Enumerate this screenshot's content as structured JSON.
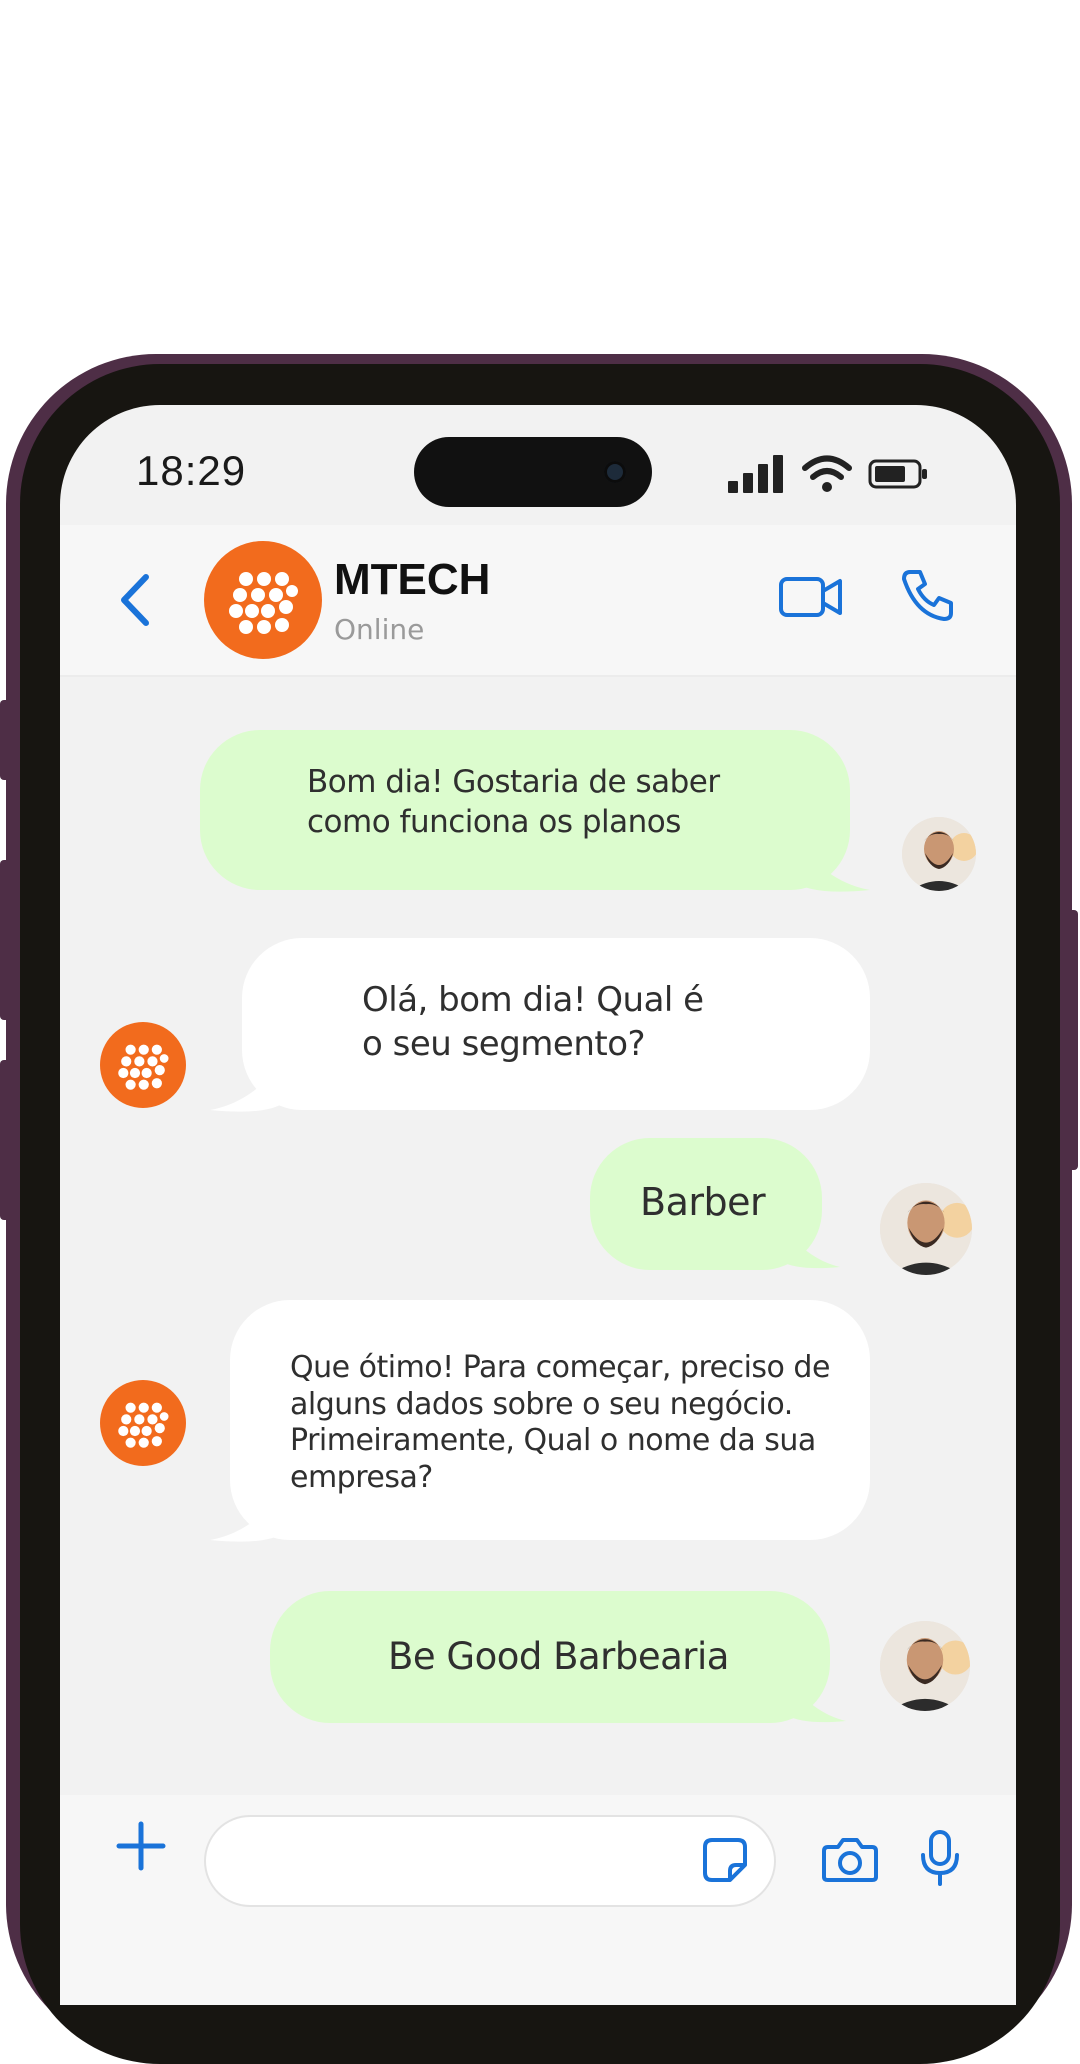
{
  "status_bar": {
    "time": "18:29"
  },
  "contact": {
    "name": "MTECH",
    "status": "Online"
  },
  "messages": [
    {
      "from": "user",
      "lines": [
        "Bom dia! Gostaria de saber",
        "como funciona os planos"
      ]
    },
    {
      "from": "bot",
      "lines": [
        "Olá, bom dia! Qual é",
        "o seu segmento?"
      ]
    },
    {
      "from": "user",
      "lines": [
        "Barber"
      ]
    },
    {
      "from": "bot",
      "lines": [
        "Que ótimo! Para começar, preciso de",
        "alguns dados sobre o seu negócio.",
        "Primeiramente, Qual o nome da sua",
        "empresa?"
      ]
    },
    {
      "from": "user",
      "lines": [
        "Be Good Barbearia"
      ]
    }
  ],
  "input": {
    "placeholder": ""
  },
  "colors": {
    "accent": "#1a73d9",
    "brand": "#f26b1d",
    "user_bubble": "#dcfcce",
    "bot_bubble": "#ffffff"
  },
  "icons": [
    "back-icon",
    "video-call-icon",
    "phone-call-icon",
    "plus-icon",
    "sticker-icon",
    "camera-icon",
    "microphone-icon",
    "signal-icon",
    "wifi-icon",
    "battery-icon"
  ]
}
